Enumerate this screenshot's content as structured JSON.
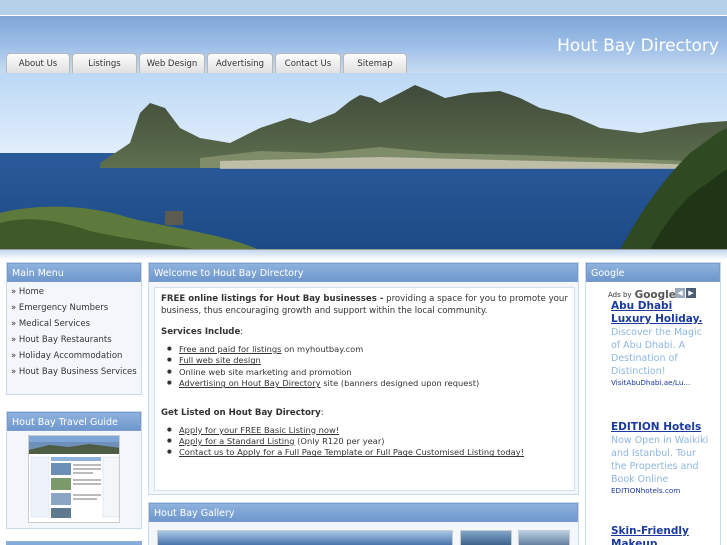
{
  "header": {
    "site_title": "Hout Bay Directory"
  },
  "nav": {
    "tabs": [
      "About Us",
      "Listings",
      "Web Design",
      "Advertising",
      "Contact Us",
      "Sitemap"
    ]
  },
  "left_menu": {
    "title": "Main Menu",
    "items": [
      "» Home",
      "» Emergency Numbers",
      "» Medical Services",
      "» Hout Bay Restaurants",
      "» Holiday Accommodation",
      "» Hout Bay Business Services"
    ]
  },
  "travel_guide": {
    "title": "Hout Bay Travel Guide"
  },
  "welcome": {
    "title": "Welcome to Hout Bay Directory",
    "intro_bold": "FREE online listings for Hout Bay businesses -",
    "intro_rest": " providing a space for you to promote your business, thus encouraging growth and support within the local community.",
    "services_heading": "Services Include",
    "services": [
      {
        "link": "Free and paid for listings",
        "rest": " on myhoutbay.com"
      },
      {
        "link": "Full web site design",
        "rest": ""
      },
      {
        "link": "",
        "rest": "Online web site marketing and promotion"
      },
      {
        "link": "Advertising on Hout Bay Directory",
        "rest": " site (banners designed upon request)"
      }
    ],
    "listed_heading": "Get Listed on Hout Bay Directory",
    "listed": [
      {
        "link": "Apply for your FREE Basic Listing now!",
        "rest": ""
      },
      {
        "link": "Apply for a Standard Listing",
        "rest": " (Only R120 per year)"
      },
      {
        "link": "Contact us to Apply for a Full Page Template or Full Page Customised Listing today!",
        "rest": ""
      }
    ]
  },
  "gallery": {
    "title": "Hout Bay Gallery"
  },
  "google_box": {
    "title": "Google",
    "ads_by": "Ads by",
    "logo": "Google",
    "ads": [
      {
        "title": "Abu Dhabi Luxury Holiday.",
        "body": "Discover the Magic of Abu Dhabi. A Destination of Distinction!",
        "url": "VisitAbuDhabi.ae/Lu..."
      },
      {
        "title": "EDITION Hotels",
        "body": "Now Open in Waikiki and Istanbul. Tour the Properties and Book Online",
        "url": "EDITIONhotels.com"
      },
      {
        "title": "Skin-Friendly Makeup",
        "body": "",
        "url": ""
      }
    ]
  },
  "colors": {
    "header_blue": "#7fa6d8",
    "box_title_blue": "#6f97cc",
    "ad_link": "#1a3a9c",
    "ad_text": "#8eb6e0"
  }
}
